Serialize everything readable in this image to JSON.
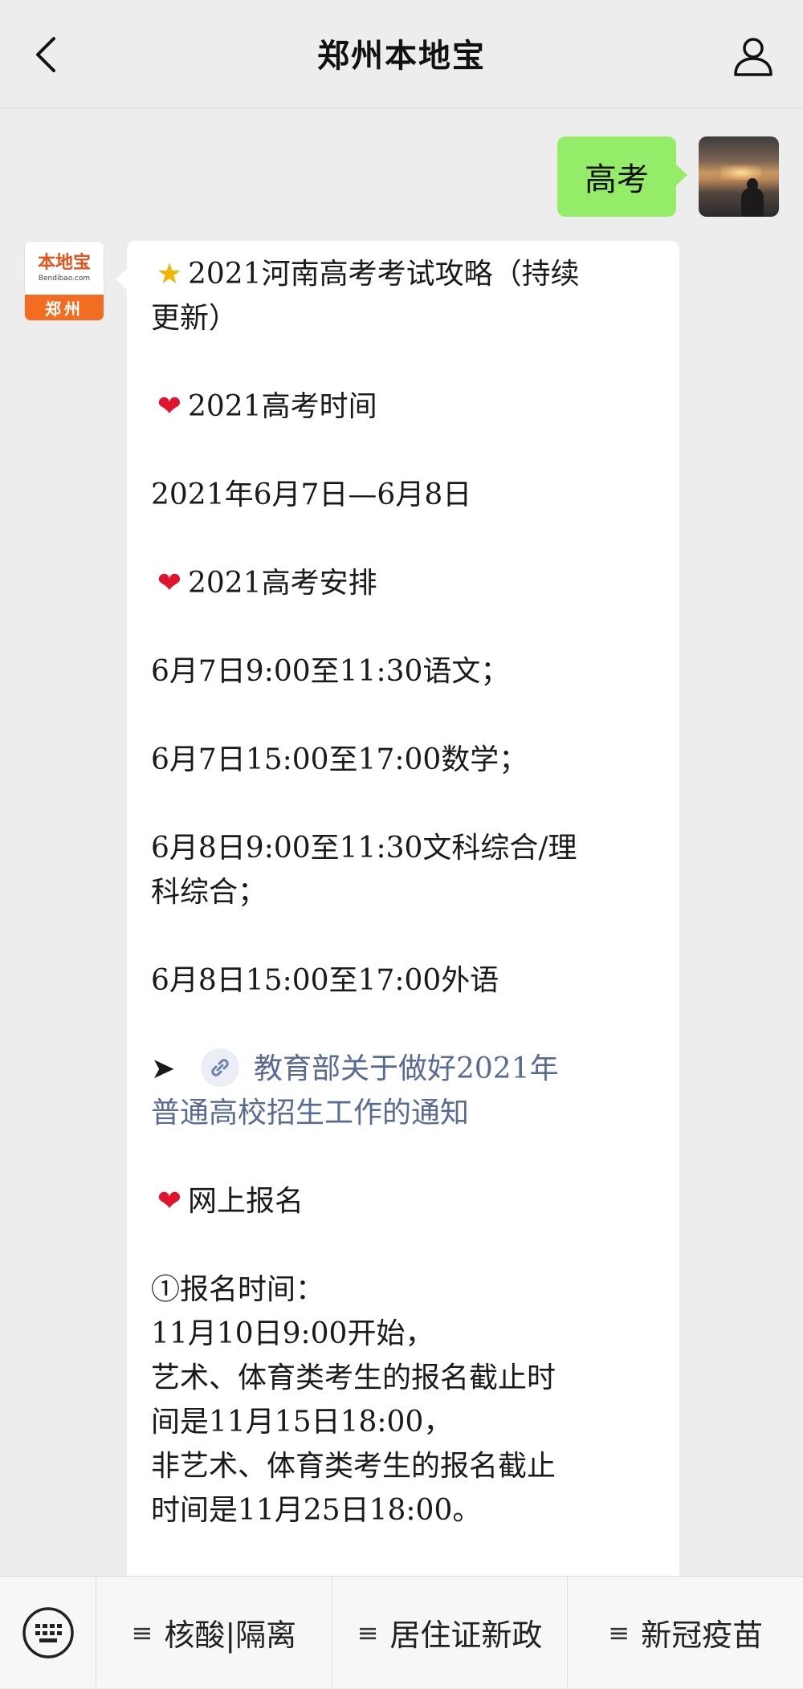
{
  "header": {
    "title": "郑州本地宝",
    "back_icon": "chevron-left-icon",
    "profile_icon": "person-icon"
  },
  "chat": {
    "outgoing": {
      "text": "高考",
      "bubble_color": "#95ec69"
    },
    "incoming": {
      "avatar": {
        "brand_name": "本地宝",
        "domain": "Bendibao.com",
        "city": "郑州"
      },
      "lines": [
        "2021河南高考考试攻略（持续",
        "更新）",
        "2021高考时间",
        "2021年6月7日—6月8日",
        "2021高考安排",
        "6月7日9:00至11:30语文；",
        "6月7日15:00至17:00数学；",
        "6月8日9:00至11:30文科综合/理",
        "科综合；",
        "6月8日15:00至17:00外语",
        "教育部关于做好2021年",
        "普通高校招生工作的通知",
        "网上报名",
        "①报名时间：",
        "11月10日9:00开始，",
        "艺术、体育类考生的报名截止时",
        "间是11月15日18:00，",
        "非艺术、体育类考生的报名截止",
        "时间是11月25日18:00。"
      ],
      "link_color": "#576b95"
    }
  },
  "bottom_menu": {
    "keyboard_icon": "keyboard-icon",
    "items": [
      {
        "label": "核酸|隔离"
      },
      {
        "label": "居住证新政"
      },
      {
        "label": "新冠疫苗"
      }
    ],
    "menu_glyph": "≡"
  }
}
